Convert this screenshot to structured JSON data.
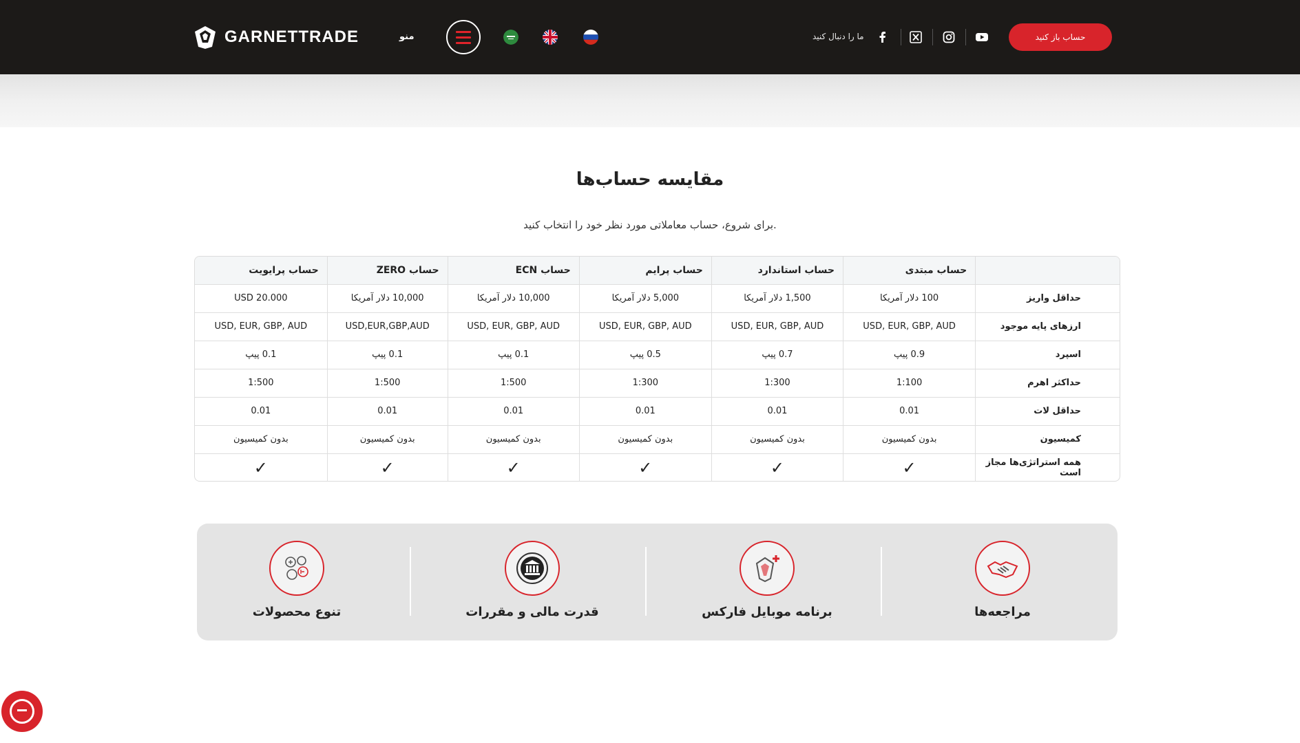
{
  "header": {
    "logo_text": "GARNETTRADE",
    "menu_label": "منو",
    "follow_text": "ما را دنبال کنید",
    "open_account": "حساب باز کنید",
    "languages": [
      "arabic",
      "english",
      "russian"
    ],
    "socials": [
      "facebook-icon",
      "x-icon",
      "instagram-icon",
      "youtube-icon"
    ]
  },
  "section": {
    "title": "مقایسه حساب‌ها",
    "subtitle": "برای شروع، حساب معاملاتی مورد نظر خود را انتخاب کنید."
  },
  "table": {
    "headers": [
      "حساب مبتدی",
      "حساب استاندارد",
      "حساب پرایم",
      "حساب ECN",
      "حساب ZERO",
      "حساب پرایویت"
    ],
    "rows": [
      {
        "label": "حداقل واریز",
        "values": [
          "100 دلار آمریکا",
          "1,500 دلار آمریکا",
          "5,000 دلار آمریکا",
          "10,000 دلار آمریکا",
          "10,000 دلار آمریکا",
          "USD 20.000"
        ]
      },
      {
        "label": "ارزهای پایه موجود",
        "values": [
          "USD, EUR, GBP, AUD",
          "USD, EUR, GBP, AUD",
          "USD, EUR, GBP, AUD",
          "USD, EUR, GBP, AUD",
          "USD,EUR,GBP,AUD",
          "USD, EUR, GBP, AUD"
        ]
      },
      {
        "label": "اسپرد",
        "values": [
          "0.9 پیپ",
          "0.7 پیپ",
          "0.5 پیپ",
          "0.1 پیپ",
          "0.1 پیپ",
          "0.1 پیپ"
        ]
      },
      {
        "label": "حداکثر اهرم",
        "values": [
          "1:100",
          "1:300",
          "1:300",
          "1:500",
          "1:500",
          "1:500"
        ]
      },
      {
        "label": "حداقل لات",
        "values": [
          "0.01",
          "0.01",
          "0.01",
          "0.01",
          "0.01",
          "0.01"
        ]
      },
      {
        "label": "کمیسیون",
        "values": [
          "بدون کمیسیون",
          "بدون کمیسیون",
          "بدون کمیسیون",
          "بدون کمیسیون",
          "بدون کمیسیون",
          "بدون کمیسیون"
        ]
      },
      {
        "label": "همه استراتژی‌ها مجاز است",
        "values": [
          "✓",
          "✓",
          "✓",
          "✓",
          "✓",
          "✓"
        ]
      }
    ]
  },
  "features": [
    {
      "label": "مراجعه‌ها",
      "icon": "handshake-icon"
    },
    {
      "label": "برنامه موبایل فارکس",
      "icon": "diamond-plus-icon"
    },
    {
      "label": "قدرت مالی و مقررات",
      "icon": "bank-seal-icon"
    },
    {
      "label": "تنوع محصولات",
      "icon": "currency-coins-icon"
    }
  ],
  "colors": {
    "header_bg": "#1c1a18",
    "accent": "#d8242b"
  }
}
